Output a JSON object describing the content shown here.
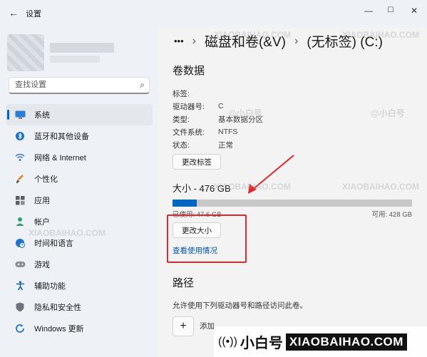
{
  "window": {
    "back_icon": "back-arrow-icon",
    "title": "设置",
    "controls": [
      "minimize-icon",
      "maximize-icon",
      "close-icon"
    ]
  },
  "search": {
    "placeholder": "查找设置",
    "icon": "search-icon"
  },
  "sidebar": {
    "items": [
      {
        "label": "系统",
        "icon": "monitor-icon",
        "active": true
      },
      {
        "label": "蓝牙和其他设备",
        "icon": "bluetooth-icon"
      },
      {
        "label": "网络 & Internet",
        "icon": "wifi-icon"
      },
      {
        "label": "个性化",
        "icon": "brush-icon"
      },
      {
        "label": "应用",
        "icon": "apps-icon"
      },
      {
        "label": "帐户",
        "icon": "person-icon"
      },
      {
        "label": "时间和语言",
        "icon": "globe-icon"
      },
      {
        "label": "游戏",
        "icon": "gamepad-icon"
      },
      {
        "label": "辅助功能",
        "icon": "accessibility-icon"
      },
      {
        "label": "隐私和安全性",
        "icon": "shield-icon"
      },
      {
        "label": "Windows 更新",
        "icon": "update-icon"
      }
    ]
  },
  "breadcrumb": {
    "ellipsis": "•••",
    "items": [
      "磁盘和卷(&V)",
      "(无标签) (C:)"
    ]
  },
  "volume": {
    "title": "卷数据",
    "props": [
      {
        "key": "标签:",
        "value": ""
      },
      {
        "key": "驱动器号:",
        "value": "C"
      },
      {
        "key": "类型:",
        "value": "基本数据分区"
      },
      {
        "key": "文件系统:",
        "value": "NTFS"
      },
      {
        "key": "状态:",
        "value": "正常"
      }
    ],
    "change_label_button": "更改标签"
  },
  "size": {
    "title": "大小 - 476 GB",
    "used_fraction": 0.1,
    "used": "已使用: 47.6 GB",
    "available": "可用: 428 GB",
    "resize_button": "更改大小",
    "usage_link": "查看使用情况"
  },
  "path": {
    "title": "路径",
    "description": "允许使用下列驱动器号和路径访问此卷。",
    "add_label": "添加"
  },
  "watermark": {
    "cn": "小白号",
    "en": "XIAOBAIHAO.COM",
    "tag": "@小白号"
  },
  "colors": {
    "accent": "#0067c0",
    "highlight": "#e0262b"
  }
}
